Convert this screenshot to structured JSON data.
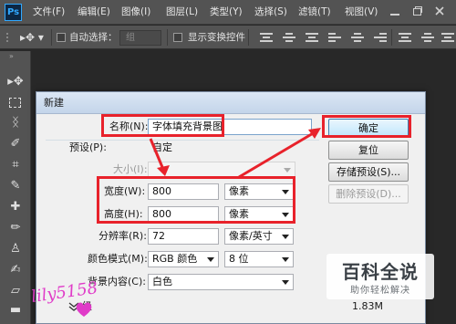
{
  "app": {
    "logo_text": "Ps"
  },
  "menu": [
    "文件(F)",
    "编辑(E)",
    "图像(I)",
    "图层(L)",
    "类型(Y)",
    "选择(S)",
    "滤镜(T)",
    "视图(V)"
  ],
  "options_bar": {
    "auto_select_label": "自动选择：",
    "auto_select_value": "组",
    "show_transform_label": "显示变换控件"
  },
  "dialog": {
    "title": "新建",
    "name_label": "名称(N):",
    "name_value": "字体填充背景图",
    "preset_label": "预设(P):",
    "preset_value": "自定",
    "size_label": "大小(I):",
    "width_label": "宽度(W):",
    "width_value": "800",
    "width_unit": "像素",
    "height_label": "高度(H):",
    "height_value": "800",
    "height_unit": "像素",
    "resolution_label": "分辨率(R):",
    "resolution_value": "72",
    "resolution_unit": "像素/英寸",
    "color_mode_label": "颜色模式(M):",
    "color_mode_value": "RGB 颜色",
    "bit_depth_value": "8 位",
    "background_label": "背景内容(C):",
    "background_value": "白色",
    "advanced_label": "级",
    "image_size_value": "1.83M",
    "buttons": {
      "ok": "确定",
      "reset": "复位",
      "save_preset": "存储预设(S)...",
      "delete_preset": "删除预设(D)..."
    }
  },
  "watermark": {
    "logo": "百科全说",
    "tagline": "助你轻松解决",
    "signature": "lily5158"
  },
  "colors": {
    "annotation_red": "#e8222b",
    "ps_blue": "#31a8ff",
    "wm_pink": "#e03bc8"
  }
}
